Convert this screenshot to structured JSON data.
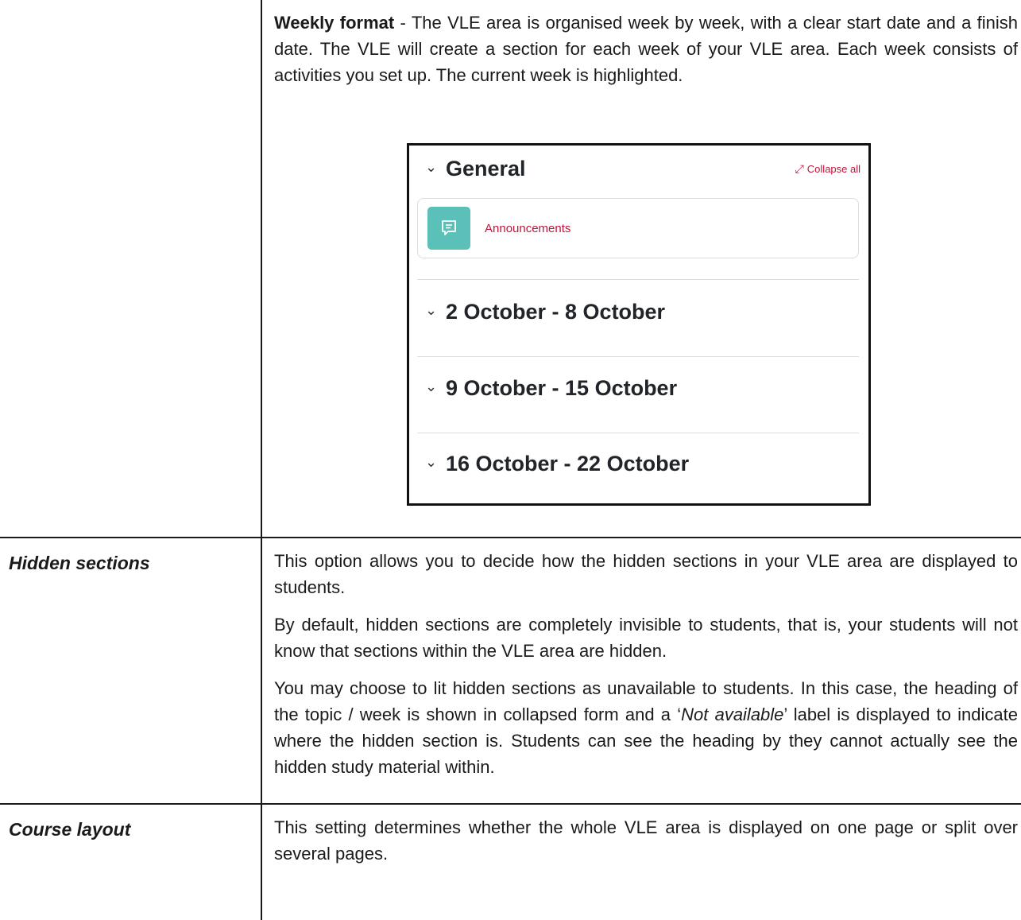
{
  "rows": [
    {
      "label": "",
      "paragraphs": [
        {
          "bold_lead": "Weekly format",
          "text": " - The VLE area is organised week by week, with a clear start date and a finish date. The VLE will create a section for each week of your VLE area. Each week consists of activities you set up. The current week is highlighted."
        }
      ]
    },
    {
      "label": "Hidden sections",
      "paragraphs": [
        {
          "text": "This option allows you to decide how the hidden sections in your VLE area are displayed to students."
        },
        {
          "text": "By default, hidden sections are completely invisible to students, that is, your students will not know that sections within the VLE area are hidden."
        },
        {
          "text_before": "You may choose to lit hidden sections as unavailable to students. In this case, the heading of the topic / week is shown in collapsed form and a ‘",
          "italic": "Not available",
          "text_after": "’ label is displayed to indicate where the hidden section is. Students can see the heading by they cannot actually see the hidden study material within."
        }
      ]
    },
    {
      "label": "Course layout",
      "paragraphs": [
        {
          "text": "This setting determines whether the whole VLE area is displayed on one page or split over several pages."
        }
      ]
    }
  ],
  "screenshot": {
    "general_title": "General",
    "collapse_all_label": "Collapse all",
    "activity_name": "Announcements",
    "activity_icon": "forum-icon",
    "weeks": [
      "2 October - 8 October",
      "9 October - 15 October",
      "16 October - 22 October"
    ],
    "accent_color": "#c0143c",
    "forum_icon_color": "#5bc0b8"
  }
}
